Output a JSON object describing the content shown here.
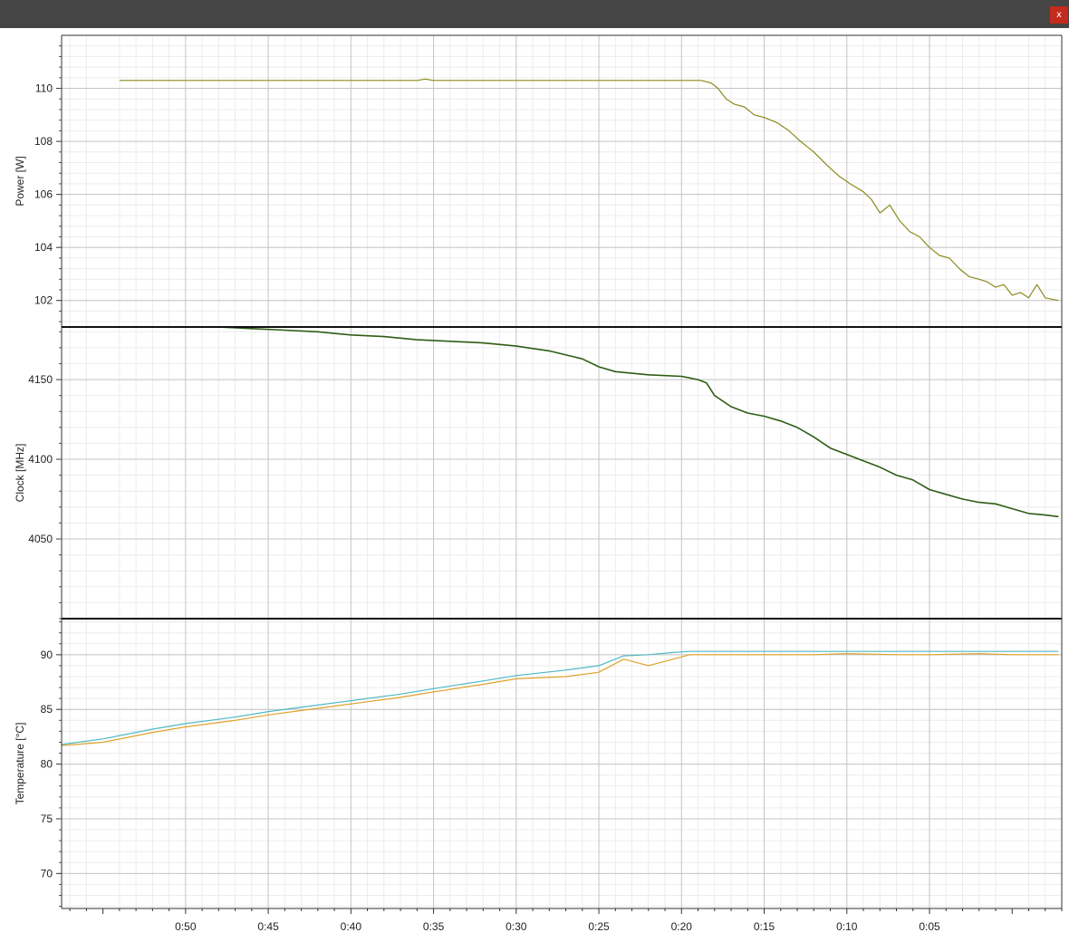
{
  "window": {
    "close_label": "x"
  },
  "chart_data": [
    {
      "type": "line",
      "ylabel": "Power [W]",
      "ylim": [
        101,
        112
      ],
      "yticks": [
        102,
        104,
        106,
        108,
        110
      ],
      "xlim": [
        57.5,
        -3.0
      ],
      "xticks": [
        {
          "value": 50,
          "label": "0:50"
        },
        {
          "value": 45,
          "label": "0:45"
        },
        {
          "value": 40,
          "label": "0:40"
        },
        {
          "value": 35,
          "label": "0:35"
        },
        {
          "value": 30,
          "label": "0:30"
        },
        {
          "value": 25,
          "label": "0:25"
        },
        {
          "value": 20,
          "label": "0:20"
        },
        {
          "value": 15,
          "label": "0:15"
        },
        {
          "value": 10,
          "label": "0:10"
        },
        {
          "value": 5,
          "label": "0:05"
        }
      ],
      "grid": true,
      "series": [
        {
          "color": "#8c8a1e",
          "x": [
            54,
            50,
            45,
            40,
            36,
            35.5,
            35,
            30,
            25,
            20,
            18.8,
            18.2,
            17.8,
            17.3,
            16.8,
            16.2,
            15.6,
            15.0,
            14.2,
            13.5,
            12.8,
            12.0,
            11.2,
            10.5,
            9.8,
            9.0,
            8.5,
            8.0,
            7.4,
            6.8,
            6.2,
            5.6,
            5.0,
            4.4,
            3.8,
            3.2,
            2.6,
            2.0,
            1.5,
            1.0,
            0.5,
            0.0,
            -0.5,
            -1.0,
            -1.5,
            -2.0,
            -2.8
          ],
          "y": [
            110.3,
            110.3,
            110.3,
            110.3,
            110.3,
            110.35,
            110.3,
            110.3,
            110.3,
            110.3,
            110.3,
            110.2,
            110.0,
            109.6,
            109.4,
            109.3,
            109.0,
            108.9,
            108.7,
            108.4,
            108.0,
            107.6,
            107.1,
            106.7,
            106.4,
            106.1,
            105.8,
            105.3,
            105.6,
            105.0,
            104.6,
            104.4,
            104.0,
            103.7,
            103.6,
            103.2,
            102.9,
            102.8,
            102.7,
            102.5,
            102.6,
            102.2,
            102.3,
            102.1,
            102.6,
            102.1,
            102.0
          ]
        }
      ]
    },
    {
      "type": "line",
      "ylabel": "Clock [MHz]",
      "ylim": [
        4000,
        4183
      ],
      "yticks": [
        4050,
        4100,
        4150
      ],
      "grid": true,
      "series": [
        {
          "color": "#2e5e14",
          "x": [
            54,
            52,
            50,
            48,
            46,
            44,
            42,
            40,
            38,
            36,
            34,
            32,
            30,
            28,
            26,
            25,
            24,
            22,
            20,
            19,
            18.5,
            18,
            17,
            16,
            15,
            14,
            13,
            12,
            11,
            10,
            9,
            8,
            7,
            6,
            5,
            4,
            3,
            2,
            1,
            0,
            -1,
            -2,
            -2.8
          ],
          "y": [
            4188,
            4186,
            4184,
            4183,
            4182,
            4181,
            4180,
            4178,
            4177,
            4175,
            4174,
            4173,
            4171,
            4168,
            4163,
            4158,
            4155,
            4153,
            4152,
            4150,
            4148,
            4140,
            4133,
            4129,
            4127,
            4124,
            4120,
            4114,
            4107,
            4103,
            4099,
            4095,
            4090,
            4087,
            4081,
            4078,
            4075,
            4073,
            4072,
            4069,
            4066,
            4065,
            4064
          ]
        }
      ]
    },
    {
      "type": "line",
      "ylabel": "Temperature [°C]",
      "ylim": [
        66.8,
        93.3
      ],
      "yticks": [
        70,
        75,
        80,
        85,
        90
      ],
      "grid": true,
      "series": [
        {
          "color": "#4fb8c4",
          "x": [
            57.5,
            55,
            52,
            50,
            47,
            45,
            42,
            40,
            37,
            35,
            32,
            30,
            27,
            25,
            23.5,
            22,
            20.5,
            19.5,
            17,
            15,
            12,
            10,
            7,
            5,
            2,
            0,
            -2.8
          ],
          "y": [
            81.8,
            82.3,
            83.2,
            83.7,
            84.3,
            84.8,
            85.4,
            85.8,
            86.4,
            86.9,
            87.6,
            88.1,
            88.6,
            89.0,
            89.9,
            90.0,
            90.2,
            90.3,
            90.3,
            90.3,
            90.3,
            90.3,
            90.3,
            90.3,
            90.3,
            90.3,
            90.3
          ]
        },
        {
          "color": "#e0a22a",
          "x": [
            57.5,
            55,
            52,
            50,
            47,
            45,
            42,
            40,
            37,
            35,
            32,
            30,
            27,
            25,
            23.5,
            22,
            20.5,
            19.5,
            17,
            15,
            12,
            10,
            7,
            5,
            2,
            0,
            -2.8
          ],
          "y": [
            81.7,
            82.0,
            82.9,
            83.4,
            84.0,
            84.5,
            85.1,
            85.5,
            86.1,
            86.6,
            87.3,
            87.8,
            88.0,
            88.4,
            89.6,
            89.0,
            89.6,
            90.0,
            90.0,
            90.0,
            90.0,
            90.1,
            90.0,
            90.0,
            90.1,
            90.0,
            90.0
          ]
        }
      ]
    }
  ]
}
